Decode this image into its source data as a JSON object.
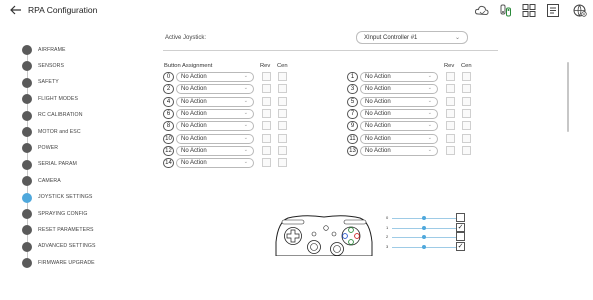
{
  "header": {
    "title": "RPA Configuration",
    "icons": [
      "cloud-icon",
      "joystick-device-icon",
      "grid-layout-icon",
      "document-icon",
      "globe-settings-icon"
    ]
  },
  "sidebar": {
    "items": [
      {
        "label": "AIRFRAME",
        "active": false
      },
      {
        "label": "SENSORS",
        "active": false
      },
      {
        "label": "SAFETY",
        "active": false
      },
      {
        "label": "FLIGHT MODES",
        "active": false
      },
      {
        "label": "RC CALIBRATION",
        "active": false
      },
      {
        "label": "MOTOR and ESC",
        "active": false
      },
      {
        "label": "POWER",
        "active": false
      },
      {
        "label": "SERIAL PARAM",
        "active": false
      },
      {
        "label": "CAMERA",
        "active": false
      },
      {
        "label": "JOYSTICK SETTINGS",
        "active": true
      },
      {
        "label": "SPRAYING CONFIG",
        "active": false
      },
      {
        "label": "RESET PARAMETERS",
        "active": false
      },
      {
        "label": "ADVANCED SETTINGS",
        "active": false
      },
      {
        "label": "FIRMWARE UPGRADE",
        "active": false
      }
    ]
  },
  "joystick": {
    "active_label": "Active Joystick:",
    "active_value": "XInput Controller #1"
  },
  "buttons": {
    "header_assignment": "Button Assignment",
    "header_rev": "Rev",
    "header_cen": "Cen",
    "left": [
      {
        "num": "0",
        "action": "No Action"
      },
      {
        "num": "2",
        "action": "No Action"
      },
      {
        "num": "4",
        "action": "No Action"
      },
      {
        "num": "6",
        "action": "No Action"
      },
      {
        "num": "8",
        "action": "No Action"
      },
      {
        "num": "10",
        "action": "No Action"
      },
      {
        "num": "12",
        "action": "No Action"
      },
      {
        "num": "14",
        "action": "No Action"
      }
    ],
    "right": [
      {
        "num": "1",
        "action": "No Action"
      },
      {
        "num": "3",
        "action": "No Action"
      },
      {
        "num": "5",
        "action": "No Action"
      },
      {
        "num": "7",
        "action": "No Action"
      },
      {
        "num": "9",
        "action": "No Action"
      },
      {
        "num": "11",
        "action": "No Action"
      },
      {
        "num": "13",
        "action": "No Action"
      }
    ]
  },
  "axes": [
    {
      "label": "0",
      "value": 0.5,
      "checked": false
    },
    {
      "label": "1",
      "value": 0.5,
      "checked": true
    },
    {
      "label": "2",
      "value": 0.5,
      "checked": false
    },
    {
      "label": "3",
      "value": 0.5,
      "checked": true
    }
  ],
  "colors": {
    "accent": "#4fa8dc",
    "dot": "#5a5a5a"
  }
}
